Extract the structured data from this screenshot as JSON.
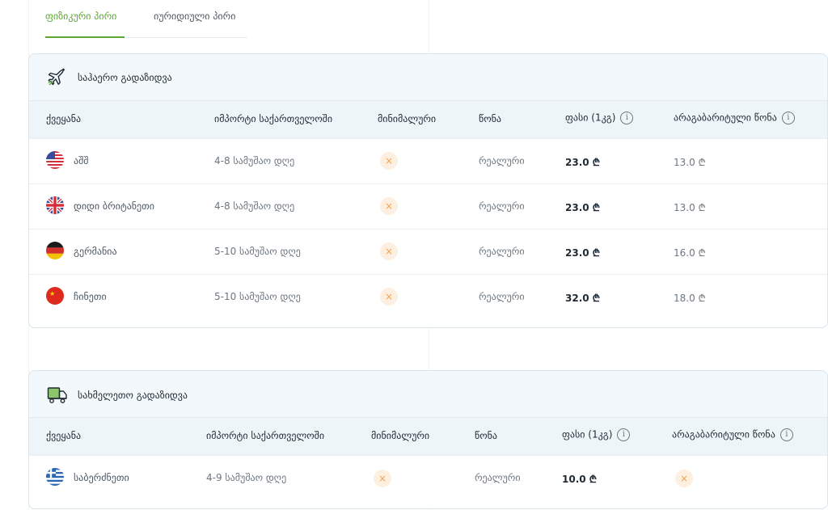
{
  "tabs": [
    {
      "label": "ფიზიკური პირი",
      "active": true
    },
    {
      "label": "იურიდიული პირი",
      "active": false
    }
  ],
  "colors": {
    "accent": "#5aa832",
    "header_bg": "#f2f8fb",
    "x_badge": "#fdf0e0"
  },
  "air": {
    "title": "საჰაერო გადაზიდვა",
    "icon": "airplane-icon",
    "headers": {
      "country": "ქვეყანა",
      "import": "იმპორტი საქართველოში",
      "minimal": "მინიმალური",
      "weight": "წონა",
      "price": "ფასი (1კგ)",
      "volumetric": "არაგაბარიტული წონა"
    },
    "rows": [
      {
        "flag": "us-flag-icon",
        "country": "აშშ",
        "days": "4-8 სამუშაო დღე",
        "weight": "რეალური",
        "price": "23.0 ₾",
        "volumetric": "13.0 ₾"
      },
      {
        "flag": "uk-flag-icon",
        "country": "დიდი ბრიტანეთი",
        "days": "4-8 სამუშაო დღე",
        "weight": "რეალური",
        "price": "23.0 ₾",
        "volumetric": "13.0 ₾"
      },
      {
        "flag": "de-flag-icon",
        "country": "გერმანია",
        "days": "5-10 სამუშაო დღე",
        "weight": "რეალური",
        "price": "23.0 ₾",
        "volumetric": "16.0 ₾"
      },
      {
        "flag": "cn-flag-icon",
        "country": "ჩინეთი",
        "days": "5-10 სამუშაო დღე",
        "weight": "რეალური",
        "price": "32.0 ₾",
        "volumetric": "18.0 ₾"
      }
    ]
  },
  "land": {
    "title": "სახმელეთო გადაზიდვა",
    "icon": "truck-icon",
    "headers": {
      "country": "ქვეყანა",
      "import": "იმპორტი საქართველოში",
      "minimal": "მინიმალური",
      "weight": "წონა",
      "price": "ფასი (1კგ)",
      "volumetric": "არაგაბარიტული წონა"
    },
    "rows": [
      {
        "flag": "gr-flag-icon",
        "country": "საბერძნეთი",
        "days": "4-9 სამუშაო დღე",
        "weight": "რეალური",
        "price": "10.0 ₾"
      }
    ]
  },
  "icons": {
    "x_mark": "×",
    "info": "i"
  }
}
